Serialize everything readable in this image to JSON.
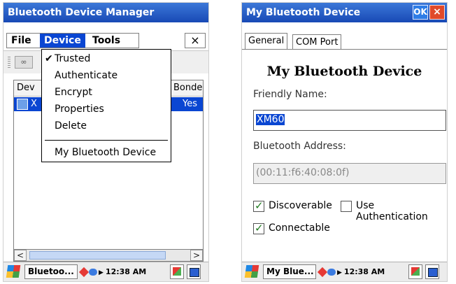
{
  "left": {
    "title": "Bluetooth Device Manager",
    "menus": [
      "File",
      "Device",
      "Tools"
    ],
    "close_label": "×",
    "toolbar": {
      "button_icon": "link-icon",
      "button_glyph": "∞"
    },
    "list": {
      "columns": [
        "Dev",
        "Bonde"
      ],
      "rows": [
        {
          "name": "X",
          "bonded": "Yes"
        }
      ]
    },
    "scroll": {
      "left": "<",
      "right": ">"
    },
    "device_menu": {
      "items": [
        {
          "label": "Trusted",
          "checked": true,
          "check_glyph": "✔"
        },
        {
          "label": "Authenticate"
        },
        {
          "label": "Encrypt"
        },
        {
          "label": "Properties"
        },
        {
          "label": "Delete"
        },
        {
          "label": "My Bluetooth Device"
        }
      ]
    },
    "taskbar": {
      "app_label": "Bluetoo...",
      "clock": "12:38 AM"
    }
  },
  "right": {
    "title": "My Bluetooth Device",
    "ok_label": "OK",
    "close_label": "×",
    "tabs": [
      "General",
      "COM Port"
    ],
    "heading": "My Bluetooth Device",
    "friendly_name_label": "Friendly Name:",
    "friendly_name_value": "XM60",
    "address_label": "Bluetooth Address:",
    "address_value": "(00:11:f6:40:08:0f)",
    "checkboxes": {
      "discoverable": {
        "label": "Discoverable",
        "checked": true
      },
      "use_auth": {
        "label": "Use Authentication",
        "checked": false
      },
      "connectable": {
        "label": "Connectable",
        "checked": true
      }
    },
    "taskbar": {
      "app_label": "My Blue...",
      "clock": "12:38 AM"
    }
  },
  "colors": {
    "titlebar": "#1849b5",
    "selection": "#0a46d2",
    "ok": "#2e7de6",
    "close": "#e04a2a"
  }
}
